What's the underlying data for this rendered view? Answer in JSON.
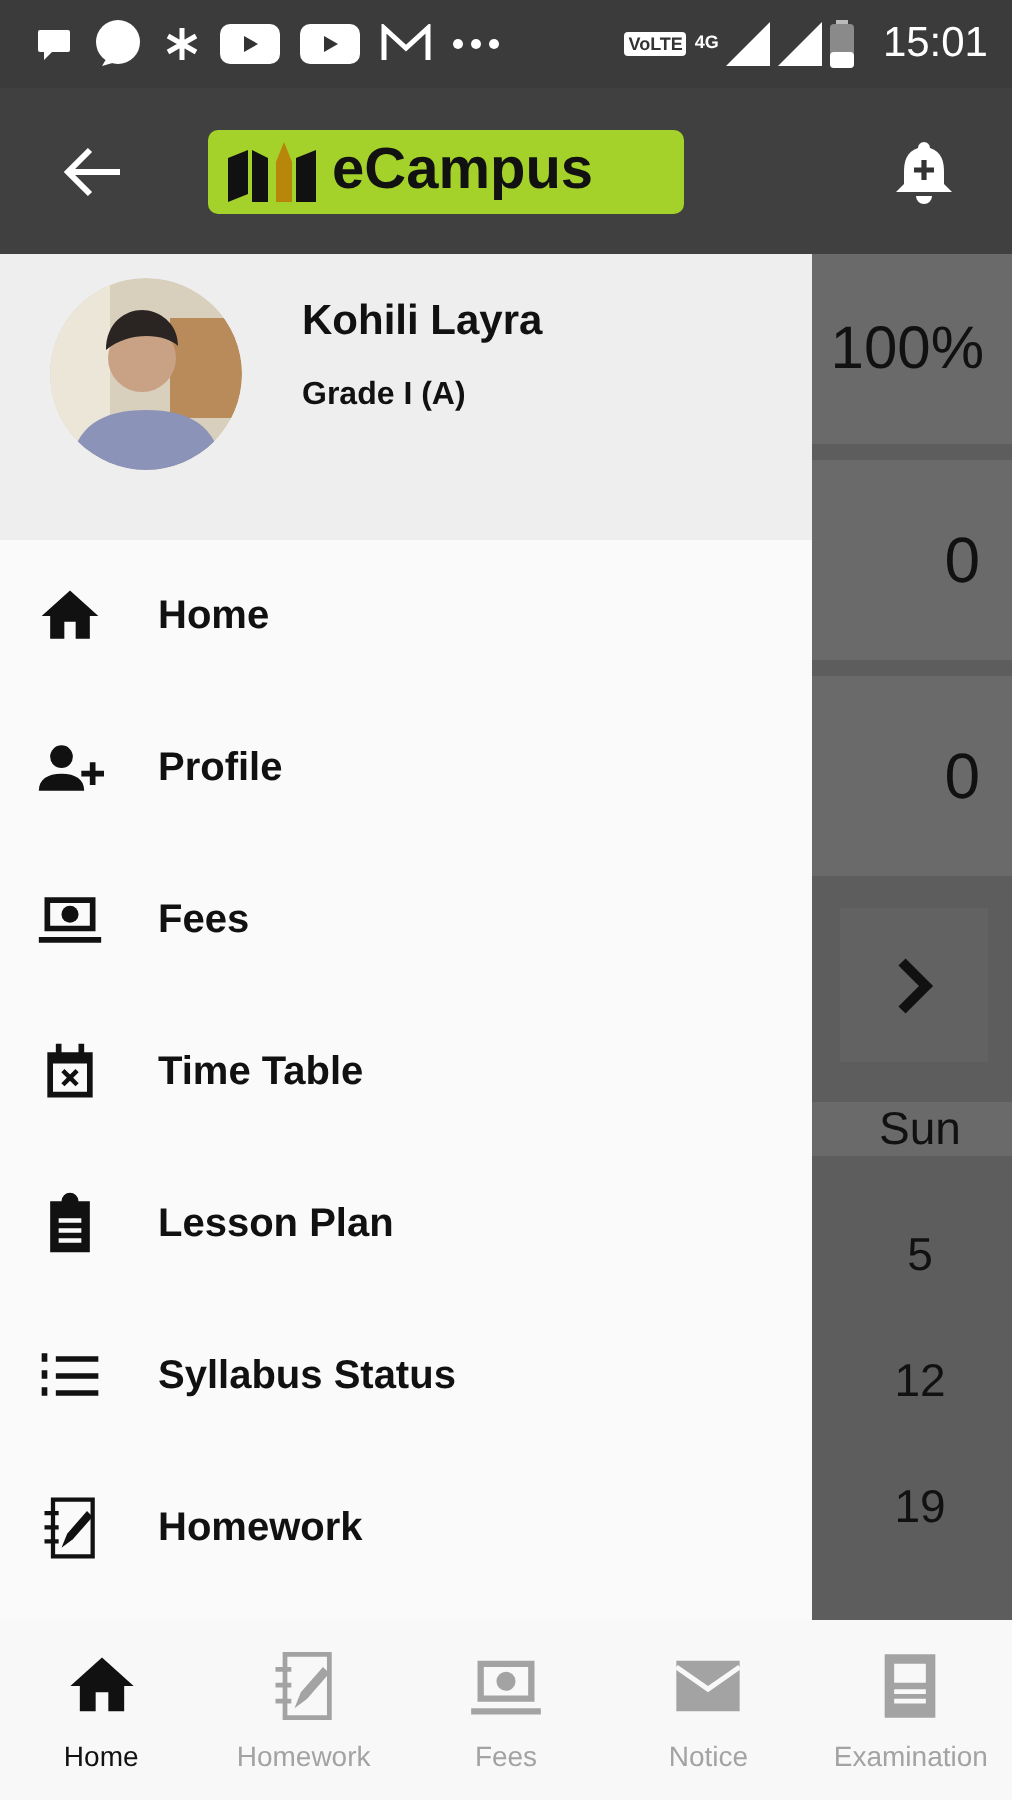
{
  "status_bar": {
    "network_badge": "VoLTE",
    "network_type": "4G",
    "time": "15:01"
  },
  "app_bar": {
    "logo_text": "eCampus"
  },
  "drawer": {
    "user": {
      "name": "Kohili Layra",
      "class": "Grade I (A)"
    },
    "items": [
      {
        "label": "Home"
      },
      {
        "label": "Profile"
      },
      {
        "label": "Fees"
      },
      {
        "label": "Time Table"
      },
      {
        "label": "Lesson Plan"
      },
      {
        "label": "Syllabus Status"
      },
      {
        "label": "Homework"
      }
    ]
  },
  "background_page": {
    "cards": [
      {
        "value": "100%"
      },
      {
        "value": "0"
      },
      {
        "value": "0"
      }
    ],
    "day_header": "Sun",
    "dates": [
      "5",
      "12",
      "19"
    ]
  },
  "bottom_nav": [
    {
      "label": "Home",
      "selected": true
    },
    {
      "label": "Homework",
      "selected": false
    },
    {
      "label": "Fees",
      "selected": false
    },
    {
      "label": "Notice",
      "selected": false
    },
    {
      "label": "Examination",
      "selected": false
    }
  ]
}
